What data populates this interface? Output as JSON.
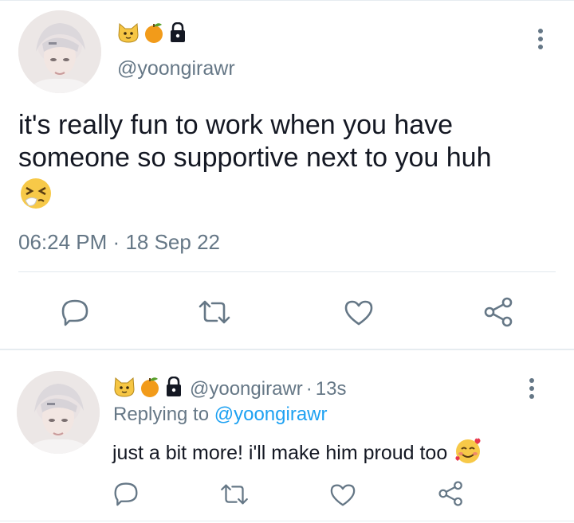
{
  "main_tweet": {
    "author_emojis": [
      "cat-face",
      "tangerine",
      "lock"
    ],
    "handle": "@yoongirawr",
    "text": "it's really fun to work when you have someone so supportive next to you huh",
    "trailing_emoji": "sneezing-face",
    "timestamp": "06:24 PM",
    "separator": "·",
    "date": "18 Sep 22",
    "actions": [
      "reply-icon",
      "retweet-icon",
      "like-icon",
      "share-icon"
    ]
  },
  "reply_tweet": {
    "author_emojis": [
      "cat-face",
      "tangerine",
      "lock"
    ],
    "handle": "@yoongirawr",
    "separator": "·",
    "time_ago": "13s",
    "replying_prefix": "Replying to",
    "replying_to": "@yoongirawr",
    "text": "just a bit more! i'll make him proud too",
    "trailing_emoji": "smiling-face-with-hearts",
    "actions": [
      "reply-icon",
      "retweet-icon",
      "like-icon",
      "share-icon"
    ]
  },
  "colors": {
    "text": "#141823",
    "secondary": "#657786",
    "link": "#1da1f2",
    "icon": "#657786",
    "divider": "#e1e8ed"
  }
}
